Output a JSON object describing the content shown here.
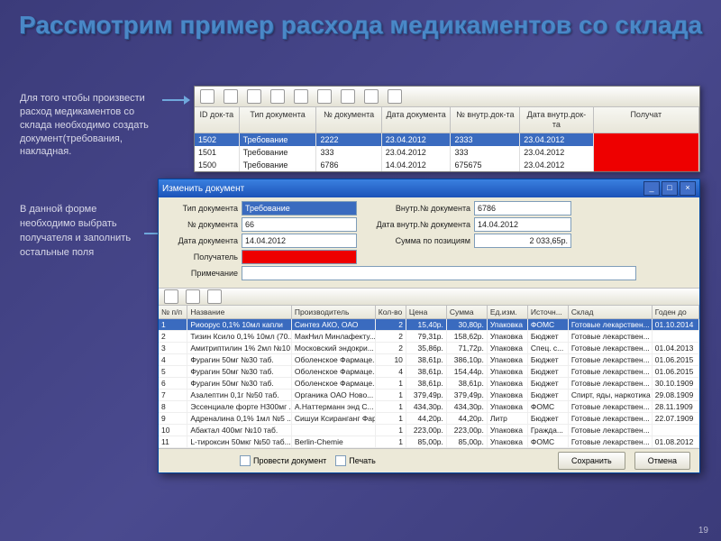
{
  "title": "Рассмотрим пример расхода медикаментов со склада",
  "desc1": "Для того чтобы произвести расход медикаментов со склада необходимо создать документ(требования, накладная.",
  "desc2": "В данной форме необходимо выбрать получателя и заполнить остальные поля",
  "slide_num": "19",
  "grid1": {
    "headers": [
      "ID док-та",
      "Тип документа",
      "№ документа",
      "Дата документа",
      "№ внутр.док-та",
      "Дата внутр.док-та",
      "Получат"
    ],
    "rows": [
      {
        "sel": true,
        "c": [
          "1502",
          "Требование",
          "2222",
          "23.04.2012",
          "2333",
          "23.04.2012",
          ""
        ]
      },
      {
        "sel": false,
        "c": [
          "1501",
          "Требование",
          "333",
          "23.04.2012",
          "333",
          "23.04.2012",
          ""
        ]
      },
      {
        "sel": false,
        "c": [
          "1500",
          "Требование",
          "6786",
          "14.04.2012",
          "675675",
          "23.04.2012",
          ""
        ]
      }
    ]
  },
  "win2": {
    "title": "Изменить документ",
    "labels": {
      "tip": "Тип документа",
      "num": "№ документа",
      "data": "Дата документа",
      "pol": "Получатель",
      "prim": "Примечание",
      "vnutr": "Внутр.№ документа",
      "datavn": "Дата внутр.№ документа",
      "summa": "Сумма по позициям"
    },
    "vals": {
      "tip": "Требование",
      "num": "66",
      "data": "14.04.2012",
      "vnutr": "6786",
      "datavn": "14.04.2012",
      "summa": "2 033,65р."
    },
    "bb": {
      "chk1": "Провести документ",
      "chk2": "Печать",
      "save": "Сохранить",
      "cancel": "Отмена"
    }
  },
  "grid2": {
    "headers": [
      "№ п/п",
      "Название",
      "Производитель",
      "Кол-во",
      "Цена",
      "Сумма",
      "Ед.изм.",
      "Источн...",
      "Склад",
      "Годен до"
    ],
    "rows": [
      {
        "sel": true,
        "c": [
          "1",
          "Риоорус 0,1% 10мл капли",
          "Синтез АКО, ОАО",
          "2",
          "15,40р.",
          "30,80р.",
          "Упаковка",
          "ФОМС",
          "Готовые лекарствен...",
          "01.10.2014"
        ]
      },
      {
        "sel": false,
        "c": [
          "2",
          "Тизин Ксило 0,1% 10мл (70...",
          "МакНил Минлафекту...",
          "2",
          "79,31р.",
          "158,62р.",
          "Упаковка",
          "Бюджет",
          "Готовые лекарствен...",
          ""
        ]
      },
      {
        "sel": false,
        "c": [
          "3",
          "Амитриптилин 1% 2мл №10 а...",
          "Московский эндокри...",
          "2",
          "35,86р.",
          "71,72р.",
          "Упаковка",
          "Спец. с...",
          "Готовые лекарствен...",
          "01.04.2013"
        ]
      },
      {
        "sel": false,
        "c": [
          "4",
          "Фурагин 50мг №30 таб.",
          "Оболенское Фармаце...",
          "10",
          "38,61р.",
          "386,10р.",
          "Упаковка",
          "Бюджет",
          "Готовые лекарствен...",
          "01.06.2015"
        ]
      },
      {
        "sel": false,
        "c": [
          "5",
          "Фурагин 50мг №30 таб.",
          "Оболенское Фармаце...",
          "4",
          "38,61р.",
          "154,44р.",
          "Упаковка",
          "Бюджет",
          "Готовые лекарствен...",
          "01.06.2015"
        ]
      },
      {
        "sel": false,
        "c": [
          "6",
          "Фурагин 50мг №30 таб.",
          "Оболенское Фармаце...",
          "1",
          "38,61р.",
          "38,61р.",
          "Упаковка",
          "Бюджет",
          "Готовые лекарствен...",
          "30.10.1909"
        ]
      },
      {
        "sel": false,
        "c": [
          "7",
          "Азалептин 0,1г №50 таб.",
          "Органика ОАО Ново...",
          "1",
          "379,49р.",
          "379,49р.",
          "Упаковка",
          "Бюджет",
          "Спирт, яды, наркотика",
          "29.08.1909"
        ]
      },
      {
        "sel": false,
        "c": [
          "8",
          "Эссенциале форте Н300мг ...",
          "А.Наттерманн энд С...",
          "1",
          "434,30р.",
          "434,30р.",
          "Упаковка",
          "ФОМС",
          "Готовые лекарствен...",
          "28.11.1909"
        ]
      },
      {
        "sel": false,
        "c": [
          "9",
          "Адреналина 0,1% 1мл №5 ...",
          "Сишуи Ксиранганг Фар...",
          "1",
          "44,20р.",
          "44,20р.",
          "Литр",
          "Бюджет",
          "Готовые лекарствен...",
          "22.07.1909"
        ]
      },
      {
        "sel": false,
        "c": [
          "10",
          "Абактал 400мг №10 таб.",
          "",
          "1",
          "223,00р.",
          "223,00р.",
          "Упаковка",
          "Гражда...",
          "Готовые лекарствен...",
          ""
        ]
      },
      {
        "sel": false,
        "c": [
          "11",
          "L-тироксин 50мкг №50 таб...",
          "Berlin-Chemie",
          "1",
          "85,00р.",
          "85,00р.",
          "Упаковка",
          "ФОМС",
          "Готовые лекарствен...",
          "01.08.2012"
        ]
      }
    ]
  }
}
